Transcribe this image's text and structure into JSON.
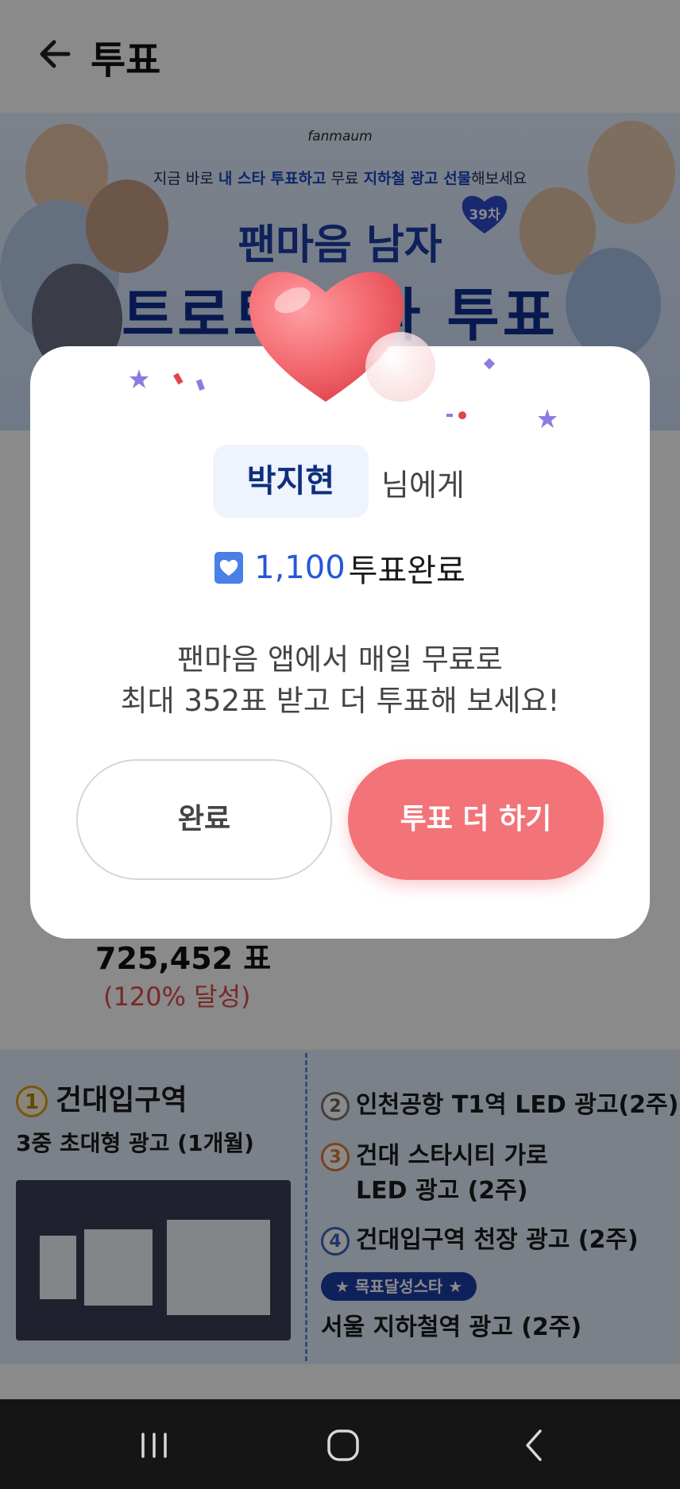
{
  "header": {
    "title": "투표",
    "back_icon": "arrow-left-icon"
  },
  "banner": {
    "logo": "fanmaum",
    "subtitle_parts": [
      "지금 바로 ",
      "내 스타 투표하고",
      " 무료 ",
      "지하철 광고 선물",
      "해보세요"
    ],
    "line1": "팬마음 남자",
    "line2": "트로트 스타 투표",
    "round_badge": "39차"
  },
  "vote_summary": {
    "count": "725,452 표",
    "achievement": "(120% 달성)"
  },
  "ads": {
    "main": {
      "num": "1",
      "title": "건대입구역",
      "subtitle": "3중 초대형 광고 (1개월)"
    },
    "items": [
      {
        "num": "2",
        "label": "인천공항 T1역 LED 광고(2주)"
      },
      {
        "num": "3",
        "label_line1": "건대 스타시티 가로",
        "label_line2": "LED 광고 (2주)"
      },
      {
        "num": "4",
        "label": "건대입구역 천장 광고 (2주)"
      }
    ],
    "badge": "★ 목표달성스타 ★",
    "last": "서울 지하철역 광고 (2주)"
  },
  "dialog": {
    "recipient_name": "박지현",
    "recipient_suffix": "님에게",
    "vote_icon": "heart-ticket-icon",
    "vote_count": "1,100",
    "vote_label": "투표완료",
    "message_line1": "팬마음 앱에서 매일 무료로",
    "message_line2": "최대 352표 받고 더 투표해 보세요!",
    "done_label": "완료",
    "more_label": "투표 더 하기",
    "accent_color": "#f27378",
    "highlight_color": "#2457d6"
  },
  "nav": {
    "recent_icon": "recent-apps-icon",
    "home_icon": "home-icon",
    "back_icon": "nav-back-icon"
  }
}
